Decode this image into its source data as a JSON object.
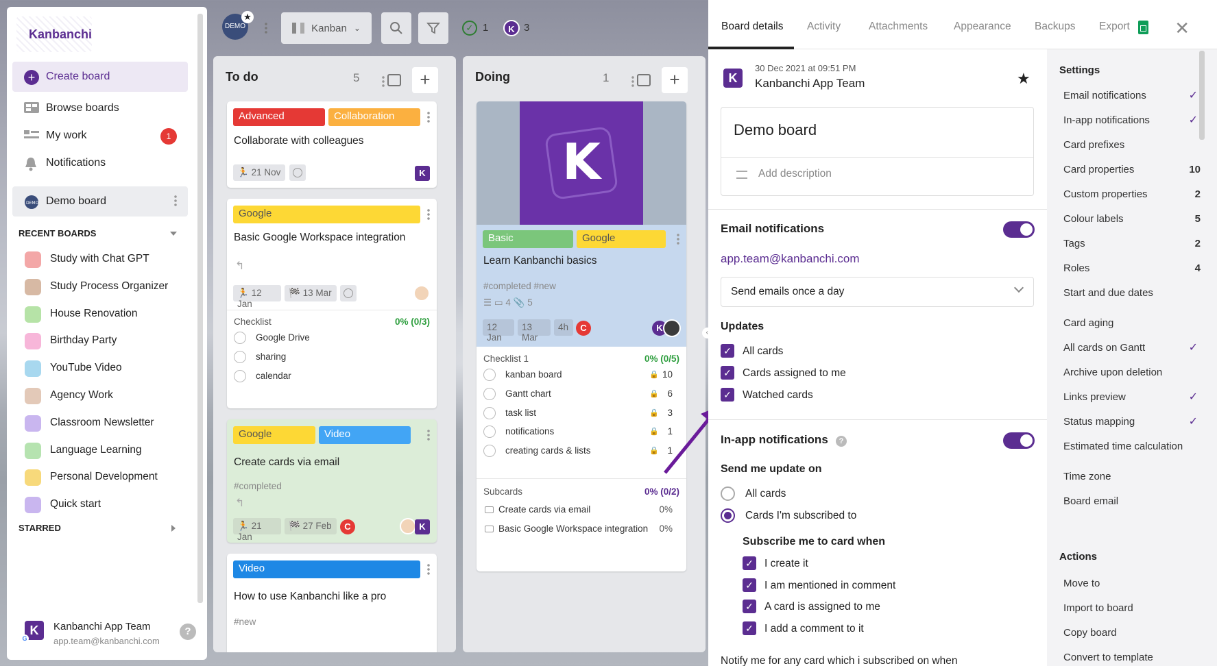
{
  "sidebar": {
    "logo": "Kanbanchi",
    "create_board": "Create board",
    "browse_boards": "Browse boards",
    "my_work": "My work",
    "my_work_badge": "1",
    "notifications": "Notifications",
    "current_board": "Demo board",
    "recent_title": "RECENT BOARDS",
    "recent": [
      {
        "label": "Study with Chat GPT",
        "color": "#f3a7a7",
        "icon": "brain-icon"
      },
      {
        "label": "Study Process Organizer",
        "color": "#d7b9a4",
        "icon": "organizer-icon"
      },
      {
        "label": "House Renovation",
        "color": "#b6e3a7",
        "icon": "lightning-icon"
      },
      {
        "label": "Birthday Party",
        "color": "#f7b6d9",
        "icon": "party-icon"
      },
      {
        "label": "YouTube Video",
        "color": "#a8d8ef",
        "icon": "globe-icon"
      },
      {
        "label": "Agency Work",
        "color": "#e3c9b8",
        "icon": "route-icon"
      },
      {
        "label": "Classroom Newsletter",
        "color": "#c9b6ef",
        "icon": "mail-icon"
      },
      {
        "label": "Language Learning",
        "color": "#b6e3b0",
        "icon": "globe-icon"
      },
      {
        "label": "Personal Development",
        "color": "#f7d97b",
        "icon": "star-icon"
      },
      {
        "label": "Quick start",
        "color": "#c9b6ef",
        "icon": "runner-icon"
      }
    ],
    "starred_title": "STARRED",
    "user_name": "Kanbanchi App Team",
    "user_email": "app.team@kanbanchi.com"
  },
  "topbar": {
    "view": "Kanban",
    "done_count": "1",
    "k_count": "3",
    "demo_badge": "DEMO"
  },
  "columns": {
    "todo": {
      "title": "To do",
      "count": "5",
      "cards": {
        "c1": {
          "tags": [
            "Advanced",
            "Collaboration"
          ],
          "title": "Collaborate with colleagues",
          "date": "21 Nov"
        },
        "c2": {
          "tag": "Google",
          "title": "Basic Google Workspace integration",
          "start": "12 Jan",
          "due": "13 Mar",
          "checklist": "Checklist",
          "progress": "0% (0/3)",
          "items": [
            "Google Drive",
            "sharing",
            "calendar"
          ]
        },
        "c3": {
          "tags": [
            "Google",
            "Video"
          ],
          "title": "Create cards via email",
          "hashtags": "#completed",
          "start": "21 Jan",
          "due": "27 Feb"
        },
        "c4": {
          "tag": "Video",
          "title": "How to use Kanbanchi like a pro",
          "hashtags": "#new"
        }
      }
    },
    "doing": {
      "title": "Doing",
      "count": "1",
      "card": {
        "tags": [
          "Basic",
          "Google"
        ],
        "title": "Learn Kanbanchi basics",
        "hashtags": "#completed #new",
        "comments": "4",
        "attachments": "5",
        "start": "12 Jan",
        "due": "13 Mar",
        "estimate": "4h",
        "checklist": "Checklist 1",
        "progress": "0% (0/5)",
        "items": [
          {
            "label": "kanban board",
            "n": "10"
          },
          {
            "label": "Gantt chart",
            "n": "6"
          },
          {
            "label": "task list",
            "n": "3"
          },
          {
            "label": "notifications",
            "n": "1"
          },
          {
            "label": "creating cards & lists",
            "n": "1"
          }
        ],
        "subcards_title": "Subcards",
        "subcards_progress": "0% (0/2)",
        "subcards": [
          {
            "label": "Create cards via email",
            "pct": "0%"
          },
          {
            "label": "Basic Google Workspace integration",
            "pct": "0%"
          }
        ]
      }
    }
  },
  "panel": {
    "tabs": [
      "Board details",
      "Activity",
      "Attachments",
      "Appearance",
      "Backups",
      "Export"
    ],
    "created": "30 Dec 2021 at 09:51 PM",
    "owner": "Kanbanchi App Team",
    "board_name": "Demo board",
    "description_placeholder": "Add description",
    "email_title": "Email notifications",
    "email_address": "app.team@kanbanchi.com",
    "email_frequency": "Send emails once a day",
    "updates_title": "Updates",
    "updates": [
      "All cards",
      "Cards assigned to me",
      "Watched cards"
    ],
    "inapp_title": "In-app notifications",
    "send_update_on": "Send me update on",
    "radio_all": "All cards",
    "radio_subscribed": "Cards I'm subscribed to",
    "subscribe_title": "Subscribe me to card when",
    "subscribe": [
      "I create it",
      "I am mentioned in comment",
      "A card is assigned to me",
      "I add a comment to it"
    ],
    "cut_text": "Notify me for any card which i subscribed on when"
  },
  "settings": {
    "title": "Settings",
    "items": [
      {
        "label": "Email notifications",
        "tick": "✓"
      },
      {
        "label": "In-app notifications",
        "tick": "✓"
      },
      {
        "label": "Card prefixes"
      },
      {
        "label": "Card properties",
        "val": "10"
      },
      {
        "label": "Custom properties",
        "val": "2"
      },
      {
        "label": "Colour labels",
        "val": "5"
      },
      {
        "label": "Tags",
        "val": "2"
      },
      {
        "label": "Roles",
        "val": "4"
      },
      {
        "label": "Start and due dates"
      },
      {
        "label": "Card aging"
      },
      {
        "label": "All cards on Gantt",
        "tick": "✓"
      },
      {
        "label": "Archive upon deletion"
      },
      {
        "label": "Links preview",
        "tick": "✓"
      },
      {
        "label": "Status mapping",
        "tick": "✓"
      },
      {
        "label": "Estimated time calculation"
      },
      {
        "label": "Time zone"
      },
      {
        "label": "Board email"
      }
    ],
    "actions_title": "Actions",
    "actions": [
      "Move to",
      "Import to board",
      "Copy board",
      "Convert to template"
    ]
  },
  "colors": {
    "brand": "#5b2d91",
    "red": "#e53935",
    "yellow": "#fdd835",
    "green": "#7bc67b",
    "blue": "#2196f3",
    "orange": "#fbb040"
  }
}
